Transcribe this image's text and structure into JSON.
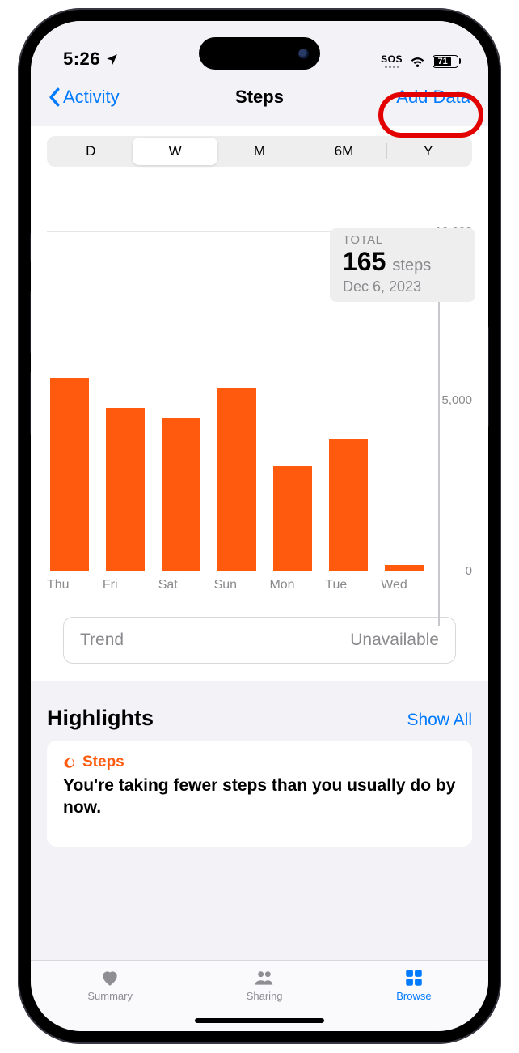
{
  "status": {
    "time": "5:26",
    "sos": "SOS",
    "battery_pct": "71"
  },
  "nav": {
    "back_label": "Activity",
    "title": "Steps",
    "action_label": "Add Data"
  },
  "segments": {
    "options": [
      "D",
      "W",
      "M",
      "6M",
      "Y"
    ],
    "selected_index": 1
  },
  "total_box": {
    "label": "TOTAL",
    "value": "165",
    "unit": "steps",
    "date": "Dec 6, 2023"
  },
  "chart_data": {
    "type": "bar",
    "categories": [
      "Thu",
      "Fri",
      "Sat",
      "Sun",
      "Mon",
      "Tue",
      "Wed"
    ],
    "values": [
      5700,
      4800,
      4500,
      5400,
      3100,
      3900,
      165
    ],
    "title": "",
    "xlabel": "",
    "ylabel": "",
    "ylim": [
      0,
      10000
    ],
    "yticks": [
      0,
      5000,
      10000
    ],
    "ytick_labels": [
      "0",
      "5,000",
      "10,000"
    ],
    "color": "#ff5a0e"
  },
  "trend": {
    "label": "Trend",
    "status": "Unavailable"
  },
  "highlights": {
    "title": "Highlights",
    "show_all": "Show All",
    "card": {
      "category": "Steps",
      "text": "You're taking fewer steps than you usually do by now."
    }
  },
  "tabs": {
    "items": [
      "Summary",
      "Sharing",
      "Browse"
    ],
    "selected_index": 2
  }
}
